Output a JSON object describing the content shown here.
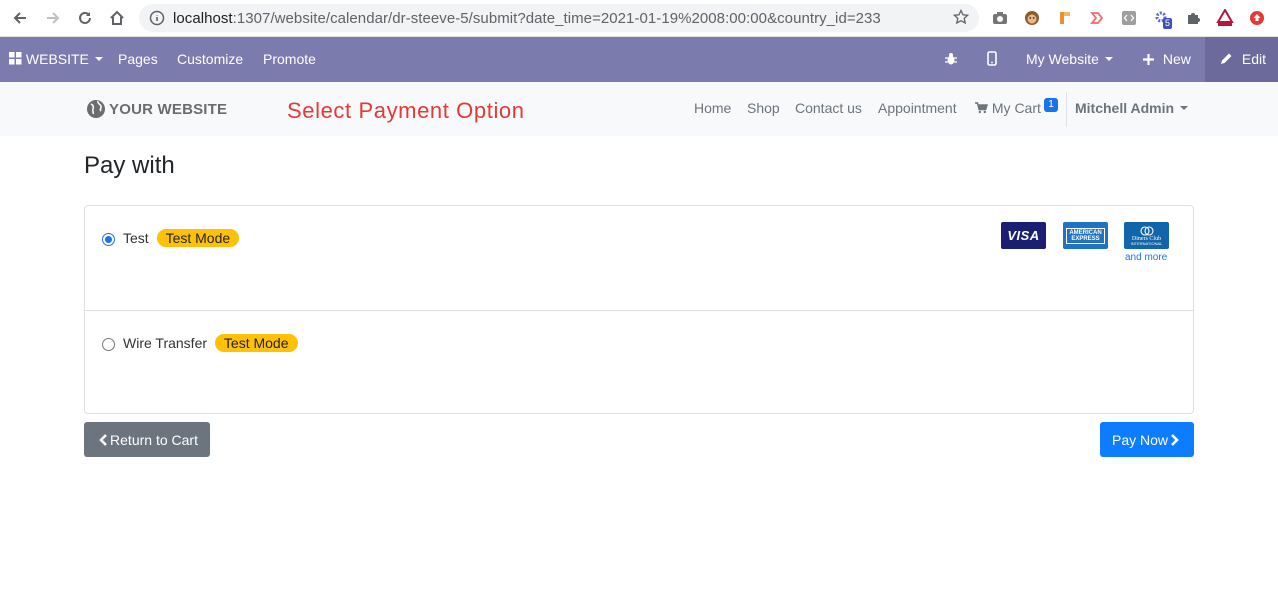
{
  "browser": {
    "url_host": "localhost",
    "url_rest": ":1307/website/calendar/dr-steeve-5/submit?date_time=2021-01-19%2008:00:00&country_id=233",
    "extension_badge": "5",
    "icons": [
      "back-arrow-icon",
      "forward-arrow-icon",
      "reload-icon",
      "home-icon",
      "info-icon",
      "star-icon",
      "camera-icon",
      "monkey-icon",
      "tag-icon",
      "arrow-extension-icon",
      "code-icon",
      "gear-extension-icon",
      "puzzle-icon",
      "axis-logo-icon",
      "red-up-icon"
    ]
  },
  "odoo_bar": {
    "app_menu": "WEBSITE",
    "pages": "Pages",
    "customize": "Customize",
    "promote": "Promote",
    "my_website": "My Website",
    "new": "New",
    "edit": "Edit",
    "bg_color": "#7c7bad"
  },
  "site_header": {
    "logo_text": "YOUR WEBSITE",
    "overlay_title": "Select Payment Option",
    "nav": [
      "Home",
      "Shop",
      "Contact us",
      "Appointment"
    ],
    "cart_label": "My Cart",
    "cart_count": "1",
    "user": "Mitchell Admin"
  },
  "main": {
    "title": "Pay with",
    "options": [
      {
        "label": "Test",
        "badge": "Test Mode",
        "checked": true
      },
      {
        "label": "Wire Transfer",
        "badge": "Test Mode",
        "checked": false
      }
    ],
    "payment_icons": {
      "visa": "VISA",
      "amex_line1": "AMERICAN",
      "amex_line2": "EXPRESS",
      "diners_line1": "Diners Club",
      "diners_line2": "INTERNATIONAL",
      "more": "and more"
    },
    "return_button": "Return to Cart",
    "pay_button": "Pay Now",
    "accent_color": "#0d7dff",
    "badge_color": "#ffc107"
  }
}
